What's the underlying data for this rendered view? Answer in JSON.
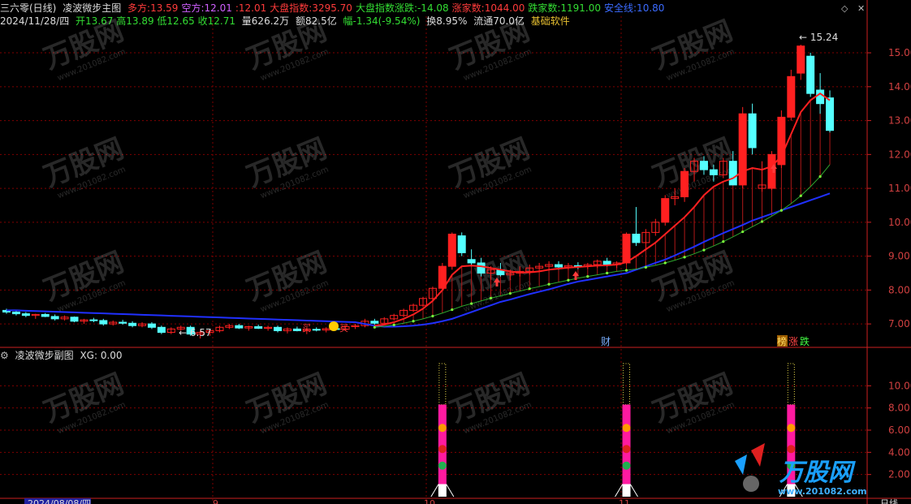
{
  "header": {
    "stock_name": "三六零(日线)",
    "indicator_name": "凌波微步主图",
    "items": [
      {
        "label": "多方:",
        "value": "13.59",
        "color": "#ff3b3b"
      },
      {
        "label": "空方:",
        "value": "12.01",
        "color": "#d060ff"
      },
      {
        "label": ":",
        "value": "12.01",
        "color": "#ff3b3b"
      },
      {
        "label": "大盘指数:",
        "value": "3295.70",
        "color": "#ff3b3b"
      },
      {
        "label": "大盘指数涨跌:",
        "value": "-14.08",
        "color": "#33dd33"
      },
      {
        "label": "涨家数:",
        "value": "1044.00",
        "color": "#ff3b3b"
      },
      {
        "label": "跌家数:",
        "value": "1191.00",
        "color": "#33dd33"
      },
      {
        "label": "安全线:",
        "value": "10.80",
        "color": "#3b6bff"
      }
    ]
  },
  "info": {
    "date": "2024/11/28/四",
    "open": "开13.67",
    "high": "高13.89",
    "low": "低12.65",
    "close": "收12.71",
    "volume": "量626.2万",
    "amount": "额82.5亿",
    "change": "幅-1.34(-9.54%)",
    "turnover": "换8.95%",
    "float": "流通70.0亿",
    "software": "基础软件"
  },
  "sub_header": {
    "name": "凌波微步副图",
    "xg": "XG: 0.00"
  },
  "labels": {
    "high_mark": "15.24",
    "low_mark": "6.57",
    "buy1": "买",
    "buy2": "买",
    "cai": "财",
    "bang": "榜",
    "zhang": "涨",
    "die": "跌",
    "period": "日线",
    "date_bottom": "2024/08/08/四",
    "month_9": "9",
    "month_10": "10",
    "month_11": "11"
  },
  "watermark": {
    "brand": "万股网",
    "url": "www.201082.com"
  },
  "colors": {
    "up": "#ff2020",
    "down": "#54ffff",
    "ma_red": "#ff2020",
    "ma_blue": "#2030ff",
    "ma_green": "#7cff3c",
    "grid": "#800000",
    "axis": "#cc2020"
  },
  "chart_data": [
    {
      "type": "candlestick",
      "title": "凌波微步主图",
      "ylim": [
        6.5,
        15.6
      ],
      "yticks": [
        "7.00",
        "8.00",
        "9.00",
        "10.00",
        "11.00",
        "12.00",
        "13.00",
        "14.00",
        "15.00"
      ],
      "candles": [
        [
          7.4,
          7.45,
          7.3,
          7.35
        ],
        [
          7.35,
          7.4,
          7.25,
          7.3
        ],
        [
          7.3,
          7.35,
          7.2,
          7.25
        ],
        [
          7.25,
          7.3,
          7.15,
          7.28
        ],
        [
          7.28,
          7.32,
          7.2,
          7.22
        ],
        [
          7.22,
          7.28,
          7.1,
          7.15
        ],
        [
          7.15,
          7.25,
          7.1,
          7.2
        ],
        [
          7.2,
          7.22,
          7.05,
          7.08
        ],
        [
          7.08,
          7.15,
          7.0,
          7.12
        ],
        [
          7.12,
          7.18,
          7.05,
          7.1
        ],
        [
          7.1,
          7.15,
          6.95,
          7.0
        ],
        [
          7.0,
          7.1,
          6.95,
          7.05
        ],
        [
          7.05,
          7.12,
          6.98,
          7.02
        ],
        [
          7.02,
          7.08,
          6.9,
          6.95
        ],
        [
          6.95,
          7.05,
          6.9,
          7.0
        ],
        [
          7.0,
          7.05,
          6.85,
          6.9
        ],
        [
          6.9,
          6.95,
          6.7,
          6.75
        ],
        [
          6.75,
          6.9,
          6.7,
          6.85
        ],
        [
          6.85,
          6.95,
          6.8,
          6.9
        ],
        [
          6.9,
          6.95,
          6.65,
          6.7
        ],
        [
          6.7,
          6.8,
          6.57,
          6.75
        ],
        [
          6.75,
          6.85,
          6.65,
          6.8
        ],
        [
          6.8,
          6.95,
          6.75,
          6.9
        ],
        [
          6.9,
          7.0,
          6.85,
          6.95
        ],
        [
          6.95,
          7.0,
          6.85,
          6.88
        ],
        [
          6.88,
          6.95,
          6.8,
          6.92
        ],
        [
          6.92,
          6.98,
          6.85,
          6.87
        ],
        [
          6.87,
          6.95,
          6.8,
          6.9
        ],
        [
          6.9,
          6.95,
          6.75,
          6.8
        ],
        [
          6.8,
          6.9,
          6.72,
          6.85
        ],
        [
          6.85,
          6.92,
          6.78,
          6.8
        ],
        [
          6.8,
          6.88,
          6.7,
          6.84
        ],
        [
          6.84,
          6.9,
          6.78,
          6.82
        ],
        [
          6.82,
          6.9,
          6.75,
          6.86
        ],
        [
          6.86,
          6.92,
          6.8,
          6.84
        ],
        [
          6.84,
          6.95,
          6.8,
          6.92
        ],
        [
          6.92,
          7.0,
          6.85,
          6.95
        ],
        [
          6.95,
          7.15,
          6.9,
          7.08
        ],
        [
          7.08,
          7.15,
          6.98,
          7.02
        ],
        [
          7.02,
          7.2,
          7.0,
          7.15
        ],
        [
          7.15,
          7.3,
          7.1,
          7.25
        ],
        [
          7.25,
          7.45,
          7.2,
          7.4
        ],
        [
          7.4,
          7.6,
          7.35,
          7.55
        ],
        [
          7.55,
          7.8,
          7.5,
          7.75
        ],
        [
          7.75,
          8.1,
          7.7,
          8.05
        ],
        [
          8.05,
          8.8,
          8.0,
          8.7
        ],
        [
          8.7,
          9.7,
          8.6,
          9.65
        ],
        [
          9.6,
          9.7,
          9.0,
          9.1
        ],
        [
          8.9,
          9.2,
          8.7,
          8.8
        ],
        [
          8.8,
          8.95,
          8.4,
          8.5
        ],
        [
          8.5,
          8.7,
          8.3,
          8.6
        ],
        [
          8.6,
          8.8,
          8.4,
          8.45
        ],
        [
          8.45,
          8.6,
          8.3,
          8.5
        ],
        [
          8.5,
          8.7,
          8.4,
          8.55
        ],
        [
          8.55,
          8.75,
          8.45,
          8.65
        ],
        [
          8.65,
          8.8,
          8.55,
          8.7
        ],
        [
          8.7,
          8.85,
          8.6,
          8.75
        ],
        [
          8.75,
          8.85,
          8.6,
          8.68
        ],
        [
          8.68,
          8.8,
          8.6,
          8.72
        ],
        [
          8.72,
          8.82,
          8.62,
          8.7
        ],
        [
          8.7,
          8.8,
          8.62,
          8.75
        ],
        [
          8.75,
          8.9,
          8.65,
          8.85
        ],
        [
          8.85,
          8.95,
          8.7,
          8.75
        ],
        [
          8.75,
          8.85,
          8.65,
          8.8
        ],
        [
          8.8,
          9.7,
          8.75,
          9.65
        ],
        [
          9.65,
          10.45,
          9.3,
          9.4
        ],
        [
          9.4,
          9.8,
          9.2,
          9.7
        ],
        [
          9.7,
          10.1,
          9.6,
          10.0
        ],
        [
          10.0,
          10.8,
          9.9,
          10.7
        ],
        [
          10.7,
          11.0,
          10.5,
          10.75
        ],
        [
          10.75,
          11.6,
          10.6,
          11.5
        ],
        [
          11.5,
          11.9,
          11.2,
          11.8
        ],
        [
          11.8,
          11.95,
          11.4,
          11.55
        ],
        [
          11.55,
          11.7,
          11.2,
          11.4
        ],
        [
          11.4,
          11.9,
          11.3,
          11.8
        ],
        [
          11.8,
          12.1,
          11.1,
          11.1
        ],
        [
          11.1,
          13.4,
          11.0,
          13.2
        ],
        [
          13.2,
          13.5,
          12.0,
          12.2
        ],
        [
          11.0,
          11.8,
          10.9,
          11.1
        ],
        [
          11.0,
          12.1,
          10.95,
          12.0
        ],
        [
          11.7,
          13.3,
          11.6,
          13.1
        ],
        [
          13.1,
          14.5,
          13.0,
          14.3
        ],
        [
          14.4,
          15.24,
          14.2,
          15.2
        ],
        [
          14.9,
          15.0,
          13.7,
          13.8
        ],
        [
          13.9,
          14.4,
          13.2,
          13.5
        ],
        [
          13.67,
          13.89,
          12.65,
          12.71
        ]
      ],
      "ma_red": [
        7.4,
        7.35,
        7.3,
        7.28,
        7.25,
        7.2,
        7.18,
        7.15,
        7.12,
        7.1,
        7.08,
        7.06,
        7.04,
        7.02,
        7.0,
        6.98,
        6.95,
        6.92,
        6.9,
        6.88,
        6.86,
        6.85,
        6.85,
        6.86,
        6.87,
        6.88,
        6.89,
        6.89,
        6.88,
        6.87,
        6.86,
        6.85,
        6.85,
        6.85,
        6.86,
        6.87,
        6.88,
        6.92,
        6.95,
        6.98,
        7.05,
        7.15,
        7.28,
        7.45,
        7.68,
        8.0,
        8.45,
        8.7,
        8.72,
        8.7,
        8.65,
        8.6,
        8.55,
        8.52,
        8.52,
        8.55,
        8.6,
        8.63,
        8.66,
        8.68,
        8.7,
        8.72,
        8.73,
        8.75,
        8.82,
        9.0,
        9.2,
        9.4,
        9.65,
        9.9,
        10.15,
        10.45,
        10.8,
        11.05,
        11.2,
        11.3,
        11.5,
        11.6,
        11.55,
        11.65,
        11.95,
        12.6,
        13.25,
        13.6,
        13.8,
        13.6
      ],
      "ma_green": [
        7.3,
        7.28,
        7.26,
        7.24,
        7.22,
        7.2,
        7.18,
        7.16,
        7.14,
        7.12,
        7.1,
        7.08,
        7.06,
        7.04,
        7.02,
        7.0,
        6.98,
        6.96,
        6.94,
        6.92,
        6.91,
        6.9,
        6.89,
        6.88,
        6.88,
        6.88,
        6.88,
        6.87,
        6.87,
        6.86,
        6.86,
        6.86,
        6.86,
        6.86,
        6.86,
        6.86,
        6.87,
        6.88,
        6.9,
        6.93,
        6.97,
        7.02,
        7.08,
        7.15,
        7.23,
        7.32,
        7.42,
        7.52,
        7.6,
        7.68,
        7.76,
        7.83,
        7.9,
        7.97,
        8.04,
        8.1,
        8.17,
        8.23,
        8.29,
        8.35,
        8.4,
        8.45,
        8.5,
        8.55,
        8.58,
        8.62,
        8.67,
        8.73,
        8.8,
        8.88,
        8.97,
        9.07,
        9.18,
        9.3,
        9.43,
        9.57,
        9.72,
        9.87,
        10.02,
        10.18,
        10.35,
        10.55,
        10.78,
        11.05,
        11.35,
        11.7
      ],
      "ma_blue": [
        7.4,
        7.4,
        7.39,
        7.38,
        7.37,
        7.36,
        7.35,
        7.34,
        7.33,
        7.32,
        7.31,
        7.3,
        7.29,
        7.28,
        7.27,
        7.26,
        7.25,
        7.24,
        7.23,
        7.22,
        7.21,
        7.2,
        7.19,
        7.18,
        7.17,
        7.16,
        7.15,
        7.14,
        7.13,
        7.12,
        7.11,
        7.1,
        7.09,
        7.08,
        7.07,
        7.06,
        7.05,
        7.0,
        6.95,
        6.92,
        6.92,
        6.93,
        6.95,
        6.98,
        7.02,
        7.08,
        7.15,
        7.25,
        7.35,
        7.45,
        7.55,
        7.65,
        7.72,
        7.8,
        7.88,
        7.95,
        8.02,
        8.1,
        8.18,
        8.25,
        8.3,
        8.35,
        8.4,
        8.45,
        8.5,
        8.6,
        8.7,
        8.8,
        8.9,
        9.02,
        9.15,
        9.28,
        9.42,
        9.55,
        9.68,
        9.8,
        9.92,
        10.05,
        10.15,
        10.25,
        10.35,
        10.45,
        10.55,
        10.65,
        10.75,
        10.85
      ]
    },
    {
      "type": "bar",
      "title": "凌波微步副图",
      "ylim": [
        0,
        12
      ],
      "yticks": [
        "2.00",
        "4.00",
        "6.00",
        "8.00",
        "10.00"
      ],
      "signals": [
        {
          "index": 45,
          "value": 12
        },
        {
          "index": 64,
          "value": 12
        },
        {
          "index": 81,
          "value": 12
        }
      ]
    }
  ]
}
